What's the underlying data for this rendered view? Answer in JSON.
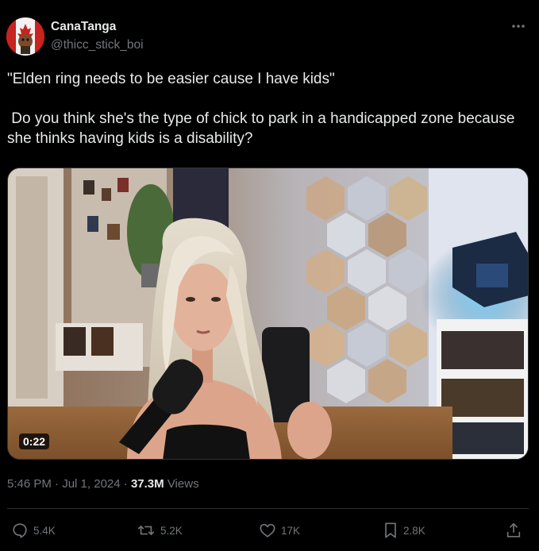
{
  "author": {
    "display_name": "CanaTanga",
    "handle": "@thicc_stick_boi",
    "avatar_icon": "canada-flag-character-avatar"
  },
  "tweet": {
    "line1": "\"Elden ring needs to be easier cause I have kids\"",
    "line2": " Do you think she's the type of chick to park in a handicapped zone because she thinks having kids is a disability?"
  },
  "video": {
    "duration": "0:22"
  },
  "meta": {
    "time": "5:46 PM",
    "separator": " · ",
    "date": "Jul 1, 2024",
    "views_count": "37.3M",
    "views_label": " Views"
  },
  "actions": {
    "replies": "5.4K",
    "reposts": "5.2K",
    "likes": "17K",
    "bookmarks": "2.8K"
  },
  "colors": {
    "background": "#000000",
    "text_primary": "#e7e9ea",
    "text_secondary": "#71767b",
    "divider": "#2f3336"
  }
}
